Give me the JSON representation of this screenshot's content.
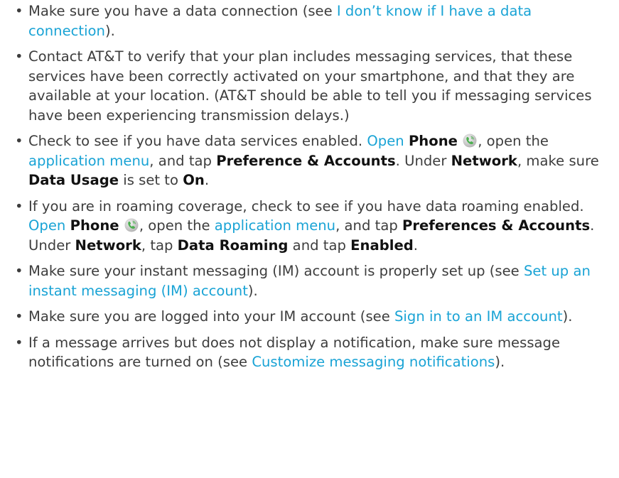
{
  "bullet_char": "•",
  "items": [
    {
      "t1": "Make sure you have a data connection (see ",
      "link1": "I don’t know if I have a data connection",
      "t2": ")."
    },
    {
      "t1": "Contact AT&T to verify that your plan includes messaging services, that these services have been correctly activated on your smartphone, and that they are available at your location. (AT&T should be able to tell you if messaging services have been experiencing transmission delays.)"
    },
    {
      "t1": "Check to see if you have data services enabled. ",
      "open": "Open",
      "phone": "Phone",
      "t2": ", open the ",
      "app_menu": "application menu",
      "t3": ", and tap ",
      "pref": "Preference & Accounts",
      "t4": ". Under ",
      "network": "Network",
      "t5": ", make sure ",
      "data_usage": "Data Usage",
      "t6": " is set to ",
      "on": "On",
      "t7": "."
    },
    {
      "t1": "If you are in roaming coverage, check to see if you have data roaming enabled. ",
      "open": "Open",
      "phone": "Phone",
      "t2": ", open the ",
      "app_menu": "application menu",
      "t3": ", and tap ",
      "pref": "Preferences & Accounts",
      "t4": ". Under ",
      "network": "Network",
      "t5": ", tap ",
      "data_roaming": "Data Roaming",
      "t6": " and tap ",
      "enabled": "Enabled",
      "t7": "."
    },
    {
      "t1": "Make sure your instant messaging (IM) account is properly set up (see ",
      "link1": "Set up an instant messaging (IM) account",
      "t2": ")."
    },
    {
      "t1": "Make sure you are logged into your IM account (see ",
      "link1": "Sign in to an IM account",
      "t2": ")."
    },
    {
      "t1": "If a message arrives but does not display a notification, make sure message notifications are turned on (see ",
      "link1": "Customize messaging notifications",
      "t2": ")."
    }
  ],
  "colors": {
    "text": "#3d3d3d",
    "bold": "#111111",
    "link": "#19a3d5",
    "icon_green": "#4caf50"
  },
  "icons": {
    "phone": "phone-handset-icon"
  }
}
